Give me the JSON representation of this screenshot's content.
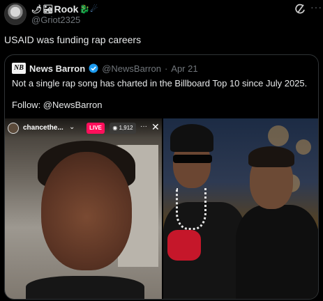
{
  "author": {
    "display_name": "Rook",
    "emojis_before": [
      "🌶",
      "🏜"
    ],
    "emojis_after": [
      "🐉",
      "☄"
    ],
    "handle": "@Griot2325",
    "avatar": "portrait-avatar"
  },
  "header_icons": {
    "grok": "grok-icon",
    "more": "more-icon"
  },
  "tweet": {
    "text": "USAID was funding rap careers"
  },
  "quote": {
    "logo_text": "NB",
    "name": "News Barron",
    "verified": true,
    "handle": "@NewsBarron",
    "separator": "·",
    "date": "Apr 21",
    "text": "Not a single rap song has charted in the Billboard Top 10 since July 2025.",
    "follow": "Follow: @NewsBarron",
    "media": {
      "left": {
        "username": "chancethe...",
        "live_label": "LIVE",
        "viewers": "1,912",
        "more": "···",
        "close": "✕"
      }
    }
  },
  "colors": {
    "background": "#000000",
    "text": "#e7e9ea",
    "muted": "#71767b",
    "border": "#2f3336",
    "verified": "#1d9bf0",
    "live": "#ff0f5b"
  }
}
